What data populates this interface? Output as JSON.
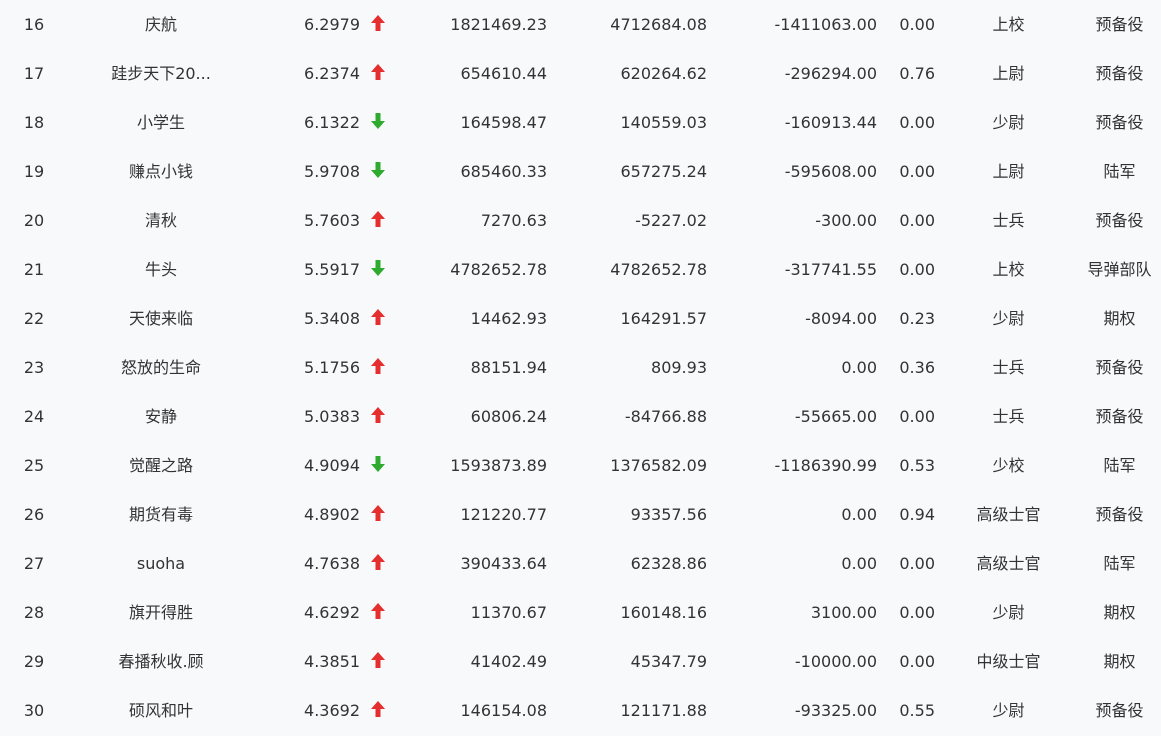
{
  "colors": {
    "up": "#e52e2e",
    "down": "#2eaa2e",
    "text": "#333333",
    "background": "#f8f9fb"
  },
  "rows": [
    {
      "rank": "16",
      "name": "庆航",
      "score": "6.2979",
      "trend": "up",
      "v1": "1821469.23",
      "v2": "4712684.08",
      "v3": "-1411063.00",
      "ratio": "0.00",
      "title": "上校",
      "branch": "预备役"
    },
    {
      "rank": "17",
      "name": "跬步天下20...",
      "score": "6.2374",
      "trend": "up",
      "v1": "654610.44",
      "v2": "620264.62",
      "v3": "-296294.00",
      "ratio": "0.76",
      "title": "上尉",
      "branch": "预备役"
    },
    {
      "rank": "18",
      "name": "小学生",
      "score": "6.1322",
      "trend": "down",
      "v1": "164598.47",
      "v2": "140559.03",
      "v3": "-160913.44",
      "ratio": "0.00",
      "title": "少尉",
      "branch": "预备役"
    },
    {
      "rank": "19",
      "name": "赚点小钱",
      "score": "5.9708",
      "trend": "down",
      "v1": "685460.33",
      "v2": "657275.24",
      "v3": "-595608.00",
      "ratio": "0.00",
      "title": "上尉",
      "branch": "陆军"
    },
    {
      "rank": "20",
      "name": "清秋",
      "score": "5.7603",
      "trend": "up",
      "v1": "7270.63",
      "v2": "-5227.02",
      "v3": "-300.00",
      "ratio": "0.00",
      "title": "士兵",
      "branch": "预备役"
    },
    {
      "rank": "21",
      "name": "牛头",
      "score": "5.5917",
      "trend": "down",
      "v1": "4782652.78",
      "v2": "4782652.78",
      "v3": "-317741.55",
      "ratio": "0.00",
      "title": "上校",
      "branch": "导弹部队"
    },
    {
      "rank": "22",
      "name": "天使来临",
      "score": "5.3408",
      "trend": "up",
      "v1": "14462.93",
      "v2": "164291.57",
      "v3": "-8094.00",
      "ratio": "0.23",
      "title": "少尉",
      "branch": "期权"
    },
    {
      "rank": "23",
      "name": "怒放的生命",
      "score": "5.1756",
      "trend": "up",
      "v1": "88151.94",
      "v2": "809.93",
      "v3": "0.00",
      "ratio": "0.36",
      "title": "士兵",
      "branch": "预备役"
    },
    {
      "rank": "24",
      "name": "安静",
      "score": "5.0383",
      "trend": "up",
      "v1": "60806.24",
      "v2": "-84766.88",
      "v3": "-55665.00",
      "ratio": "0.00",
      "title": "士兵",
      "branch": "预备役"
    },
    {
      "rank": "25",
      "name": "觉醒之路",
      "score": "4.9094",
      "trend": "down",
      "v1": "1593873.89",
      "v2": "1376582.09",
      "v3": "-1186390.99",
      "ratio": "0.53",
      "title": "少校",
      "branch": "陆军"
    },
    {
      "rank": "26",
      "name": "期货有毒",
      "score": "4.8902",
      "trend": "up",
      "v1": "121220.77",
      "v2": "93357.56",
      "v3": "0.00",
      "ratio": "0.94",
      "title": "高级士官",
      "branch": "预备役"
    },
    {
      "rank": "27",
      "name": "suoha",
      "score": "4.7638",
      "trend": "up",
      "v1": "390433.64",
      "v2": "62328.86",
      "v3": "0.00",
      "ratio": "0.00",
      "title": "高级士官",
      "branch": "陆军"
    },
    {
      "rank": "28",
      "name": "旗开得胜",
      "score": "4.6292",
      "trend": "up",
      "v1": "11370.67",
      "v2": "160148.16",
      "v3": "3100.00",
      "ratio": "0.00",
      "title": "少尉",
      "branch": "期权"
    },
    {
      "rank": "29",
      "name": "春播秋收.顾",
      "score": "4.3851",
      "trend": "up",
      "v1": "41402.49",
      "v2": "45347.79",
      "v3": "-10000.00",
      "ratio": "0.00",
      "title": "中级士官",
      "branch": "期权"
    },
    {
      "rank": "30",
      "name": "硕风和叶",
      "score": "4.3692",
      "trend": "up",
      "v1": "146154.08",
      "v2": "121171.88",
      "v3": "-93325.00",
      "ratio": "0.55",
      "title": "少尉",
      "branch": "预备役"
    }
  ]
}
